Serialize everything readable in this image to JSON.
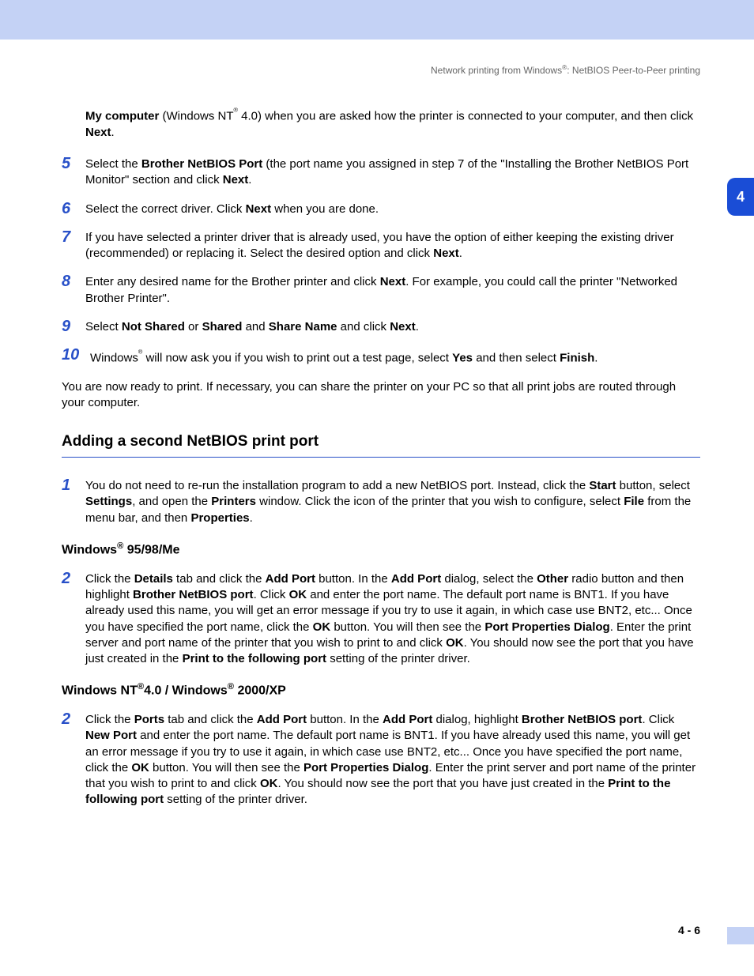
{
  "header": {
    "text": "Network printing from Windows®: NetBIOS Peer-to-Peer printing"
  },
  "chapterTab": "4",
  "intro": {
    "html": "<b>My computer</b> (Windows NT<span class='sup'>®</span> 4.0) when you are asked how the printer is connected to your computer, and then click <b>Next</b>."
  },
  "steps": [
    {
      "n": "5",
      "html": "Select the <b>Brother NetBIOS Port</b> (the port name you assigned in step 7 of the \"Installing the Brother NetBIOS Port Monitor\" section and click <b>Next</b>."
    },
    {
      "n": "6",
      "html": "Select the correct driver. Click <b>Next</b> when you are done."
    },
    {
      "n": "7",
      "html": "If you have selected a printer driver that is already used, you have the option of either keeping the existing driver (recommended) or replacing it. Select the desired option and click <b>Next</b>."
    },
    {
      "n": "8",
      "html": "Enter any desired name for the Brother printer and click <b>Next</b>. For example, you could call the printer \"Networked Brother Printer\"."
    },
    {
      "n": "9",
      "html": "Select <b>Not Shared</b> or <b>Shared</b> and <b>Share Name</b> and click <b>Next</b>."
    },
    {
      "n": "10",
      "html": "Windows<span class='sup'>®</span> will now ask you if you wish to print out a test page, select <b>Yes</b> and then select <b>Finish</b>."
    }
  ],
  "afterSteps": "You are now ready to print. If necessary, you can share the printer on your PC so that all print jobs are routed through your computer.",
  "section2": {
    "title": "Adding a second NetBIOS print port",
    "step1": {
      "n": "1",
      "html": "You do not need to re-run the installation program to add a new NetBIOS port. Instead, click the <b>Start</b> button, select <b>Settings</b>, and open the <b>Printers</b> window. Click the icon of the printer that you wish to configure, select <b>File</b> from the menu bar, and then <b>Properties</b>."
    },
    "sub1": {
      "heading": "Windows® 95/98/Me",
      "step": {
        "n": "2",
        "html": "Click the <b>Details</b> tab and click the <b>Add Port</b> button. In the <b>Add Port</b> dialog, select the <b>Other</b> radio button and then highlight <b>Brother NetBIOS port</b>. Click <b>OK</b> and enter the port name. The default port name is BNT1. If you have already used this name, you will get an error message if you try to use it again, in which case use BNT2, etc... Once you have specified the port name, click the <b>OK</b> button. You will then see the <b>Port Properties Dialog</b>. Enter the print server and port name of the printer that you wish to print to and click <b>OK</b>. You should now see the port that you have just created in the <b>Print to the following port</b> setting of the printer driver."
      }
    },
    "sub2": {
      "heading": "Windows NT®4.0 / Windows® 2000/XP",
      "step": {
        "n": "2",
        "html": "Click the <b>Ports</b> tab and click the <b>Add Port</b> button. In the <b>Add Port</b> dialog, highlight <b>Brother NetBIOS port</b>. Click <b>New Port</b> and enter the port name. The default port name is BNT1. If you have already used this name, you will get an error message if you try to use it again, in which case use BNT2, etc... Once you have specified the port name, click the <b>OK</b> button. You will then see the <b>Port Properties Dialog</b>. Enter the print server and port name of the printer that you wish to print to and click <b>OK</b>. You should now see the port that you have just created in the <b>Print to the following port</b> setting of the printer driver."
      }
    }
  },
  "footer": "4 - 6"
}
